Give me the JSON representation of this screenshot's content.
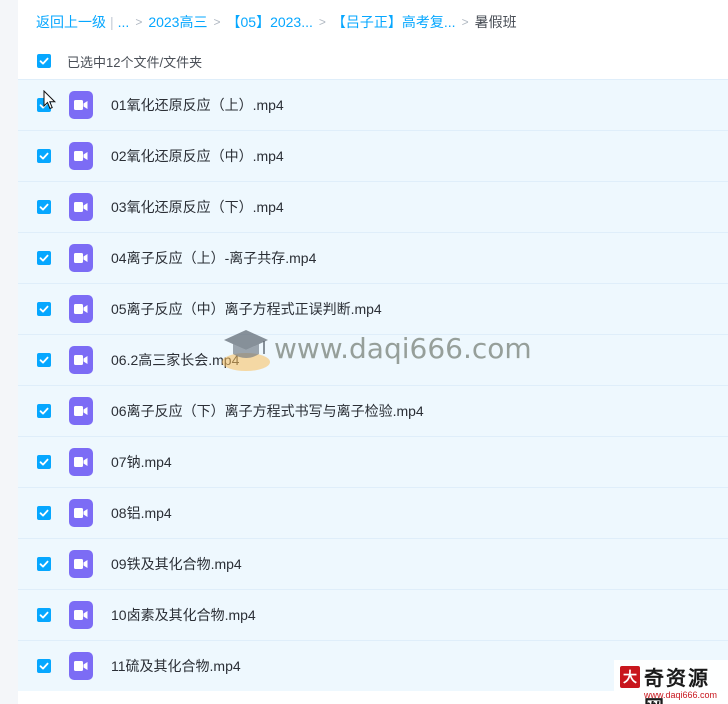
{
  "breadcrumb": {
    "back": "返回上一级",
    "ellipsis": "...",
    "sep": ">",
    "items": [
      "2023高三",
      "【05】2023...",
      "【吕子正】高考复...",
      "暑假班"
    ]
  },
  "selection": {
    "label": "已选中12个文件/文件夹"
  },
  "files": [
    {
      "name": "01氧化还原反应（上）.mp4"
    },
    {
      "name": "02氧化还原反应（中）.mp4"
    },
    {
      "name": "03氧化还原反应（下）.mp4"
    },
    {
      "name": "04离子反应（上）-离子共存.mp4"
    },
    {
      "name": "05离子反应（中）离子方程式正误判断.mp4"
    },
    {
      "name": "06.2高三家长会.mp4"
    },
    {
      "name": "06离子反应（下）离子方程式书写与离子检验.mp4"
    },
    {
      "name": "07钠.mp4"
    },
    {
      "name": "08铝.mp4"
    },
    {
      "name": "09铁及其化合物.mp4"
    },
    {
      "name": "10卤素及其化合物.mp4"
    },
    {
      "name": "11硫及其化合物.mp4"
    }
  ],
  "watermark": {
    "text": "www.daqi666.com"
  },
  "corner_logo": {
    "title": "奇资源网",
    "mark": "大",
    "url": "www.daqi666.com"
  },
  "colors": {
    "accent": "#06a7ff",
    "video_icon": "#7c6cf5",
    "row_bg": "#eef8fe"
  },
  "icons": {
    "file": "video-file-icon",
    "check": "checkmark-icon"
  }
}
